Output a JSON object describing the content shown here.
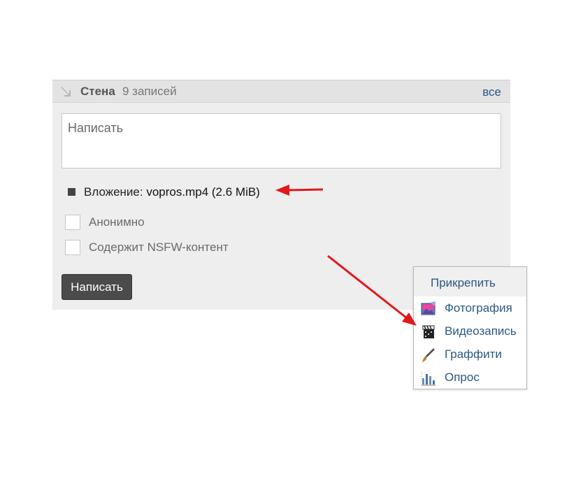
{
  "wall": {
    "title": "Стена",
    "count": "9 записей",
    "all_link": "все",
    "compose_placeholder": "Написать",
    "attachment": {
      "label": "Вложение:",
      "file": "vopros.mp4 (2.6 MiB)"
    },
    "options": [
      {
        "label": "Анонимно",
        "checked": false
      },
      {
        "label": "Содержит NSFW-контент",
        "checked": false
      }
    ],
    "submit_label": "Написать"
  },
  "attach_menu": {
    "title": "Прикрепить",
    "items": [
      {
        "label": "Фотография",
        "icon": "photo-icon"
      },
      {
        "label": "Видеозапись",
        "icon": "video-icon"
      },
      {
        "label": "Граффити",
        "icon": "brush-icon"
      },
      {
        "label": "Опрос",
        "icon": "poll-icon"
      }
    ]
  },
  "colors": {
    "link": "#2a5885",
    "annotation_arrow": "#e3161b",
    "panel_bg": "#eeeeee",
    "button_bg": "#4b4b4b"
  }
}
